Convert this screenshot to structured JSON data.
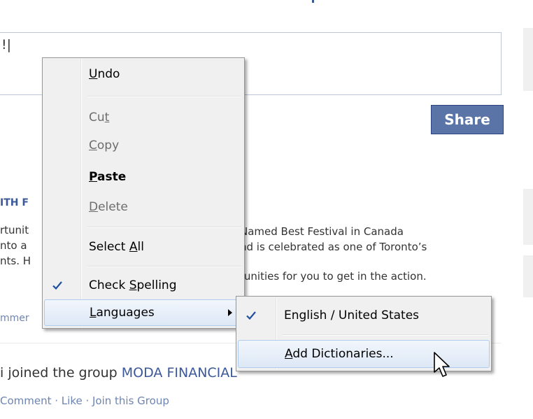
{
  "composer": {
    "text": "!|"
  },
  "share_button": {
    "label": "Share"
  },
  "story": {
    "title": "ITH F",
    "left_lines": [
      "rtunit",
      "nto a",
      "nts. H"
    ],
    "right_lines": [
      "Named Best Festival in Canada",
      "nd is celebrated as one of Toronto’s",
      "tunities for you to get in the action."
    ],
    "comment_fragment": "mmer"
  },
  "activity": {
    "prefix": "i joined the group ",
    "group_name": "MODA FINANCIAL",
    "actions": "Comment · Like · Join this Group"
  },
  "context_menu": {
    "items": [
      {
        "label_pre": "",
        "label_u": "U",
        "label_post": "ndo",
        "disabled": false,
        "bold": false,
        "checked": false
      },
      {
        "label_pre": "Cu",
        "label_u": "t",
        "label_post": "",
        "disabled": true,
        "bold": false,
        "checked": false
      },
      {
        "label_pre": "",
        "label_u": "C",
        "label_post": "opy",
        "disabled": true,
        "bold": false,
        "checked": false
      },
      {
        "label_pre": "",
        "label_u": "P",
        "label_post": "aste",
        "disabled": false,
        "bold": true,
        "checked": false
      },
      {
        "label_pre": "",
        "label_u": "D",
        "label_post": "elete",
        "disabled": true,
        "bold": false,
        "checked": false
      },
      {
        "label_pre": "Select ",
        "label_u": "A",
        "label_post": "ll",
        "disabled": false,
        "bold": false,
        "checked": false
      },
      {
        "label_pre": "Check ",
        "label_u": "S",
        "label_post": "pelling",
        "disabled": false,
        "bold": false,
        "checked": true
      },
      {
        "label_pre": "",
        "label_u": "L",
        "label_post": "anguages",
        "disabled": false,
        "bold": false,
        "checked": false,
        "has_submenu": true,
        "highlighted": true
      }
    ]
  },
  "languages_submenu": {
    "items": [
      {
        "label_pre": "English / United States",
        "label_u": "",
        "label_post": "",
        "checked": true
      },
      {
        "label_pre": "",
        "label_u": "A",
        "label_post": "dd Dictionaries...",
        "checked": false,
        "highlighted": true
      }
    ]
  },
  "colors": {
    "fb_blue": "#3b5998",
    "share_bg": "#5b74a8",
    "menu_bg": "#f0f0f0",
    "check_blue": "#1f4fa0"
  },
  "icons": {
    "check": "check-icon",
    "submenu_arrow": "chevron-right-icon",
    "cursor": "mouse-pointer-icon"
  }
}
